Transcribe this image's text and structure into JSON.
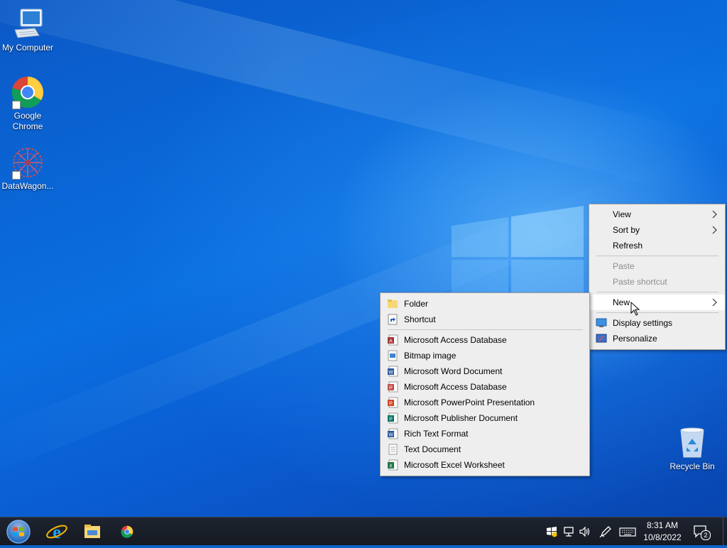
{
  "desktop": {
    "icons": [
      {
        "label": "My Computer",
        "icon": "computer-icon"
      },
      {
        "label": "Google Chrome",
        "icon": "chrome-icon"
      },
      {
        "label": "DataWagon...",
        "icon": "datawagon-icon"
      },
      {
        "label": "Recycle Bin",
        "icon": "recycle-bin-icon"
      }
    ]
  },
  "context_menu": {
    "items": [
      {
        "label": "View",
        "submenu": true
      },
      {
        "label": "Sort by",
        "submenu": true
      },
      {
        "label": "Refresh"
      },
      {
        "label": "Paste",
        "disabled": true
      },
      {
        "label": "Paste shortcut",
        "disabled": true
      },
      {
        "label": "New",
        "submenu": true,
        "highlighted": true
      },
      {
        "label": "Display settings",
        "icon": "display-settings-icon"
      },
      {
        "label": "Personalize",
        "icon": "personalize-icon"
      }
    ]
  },
  "new_submenu": {
    "items": [
      {
        "label": "Folder",
        "icon": "folder-icon"
      },
      {
        "label": "Shortcut",
        "icon": "shortcut-icon"
      },
      {
        "label": "Microsoft Access Database",
        "icon": "access-icon"
      },
      {
        "label": "Bitmap image",
        "icon": "bitmap-icon"
      },
      {
        "label": "Microsoft Word Document",
        "icon": "word-icon"
      },
      {
        "label": "Microsoft Access Database",
        "icon": "access-icon"
      },
      {
        "label": "Microsoft PowerPoint Presentation",
        "icon": "powerpoint-icon"
      },
      {
        "label": "Microsoft Publisher Document",
        "icon": "publisher-icon"
      },
      {
        "label": "Rich Text Format",
        "icon": "rtf-icon"
      },
      {
        "label": "Text Document",
        "icon": "text-document-icon"
      },
      {
        "label": "Microsoft Excel Worksheet",
        "icon": "excel-icon"
      }
    ]
  },
  "taskbar": {
    "pinned": [
      "start-orb-icon",
      "internet-explorer-icon",
      "file-explorer-icon",
      "chrome-icon"
    ],
    "tray": [
      "windows-security-icon",
      "network-icon",
      "volume-icon",
      "pen-icon",
      "keyboard-icon"
    ],
    "time": "8:31 AM",
    "date": "10/8/2022",
    "notification_count": "2"
  },
  "colors": {
    "menu_bg": "#eeeeee",
    "menu_highlight": "#ffffff",
    "taskbar_bg": "#1b1f29",
    "desktop_blue": "#0a63c9"
  }
}
